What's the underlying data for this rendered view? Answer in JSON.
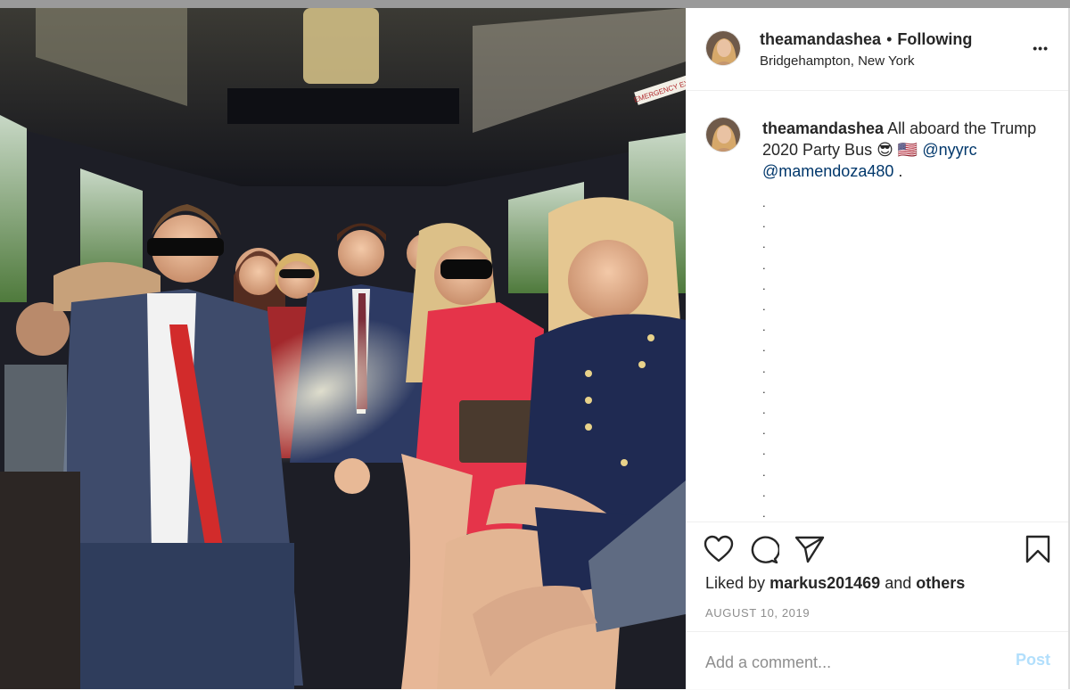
{
  "post": {
    "username": "theamandashea",
    "separator": "•",
    "follow_label": "Following",
    "location": "Bridgehampton, New York",
    "more_label": "•••"
  },
  "caption": {
    "username": "theamandashea",
    "text_part1": "All aboard the Trump 2020 Party Bus",
    "emoji_sunglasses": "😎",
    "emoji_flag": "🇺🇸",
    "mention1": "@nyyrc",
    "mention2": "@mamendoza480",
    "trailing": ".",
    "dots": [
      ".",
      ".",
      ".",
      ".",
      ".",
      ".",
      ".",
      ".",
      ".",
      ".",
      ".",
      ".",
      ".",
      ".",
      ".",
      "."
    ]
  },
  "photo": {
    "sign_text": "EMERGENCY EXIT"
  },
  "actions": {
    "icons": [
      "heart-icon",
      "comment-icon",
      "share-icon",
      "bookmark-icon"
    ]
  },
  "likes": {
    "prefix": "Liked by",
    "user": "markus201469",
    "and": "and",
    "others": "others"
  },
  "date": "AUGUST 10, 2019",
  "comment": {
    "placeholder": "Add a comment...",
    "post_label": "Post"
  },
  "colors": {
    "text": "#262626",
    "secondary": "#8e8e8e",
    "link": "#00376b",
    "post_disabled": "#b2dffc",
    "divider": "#efefef"
  }
}
